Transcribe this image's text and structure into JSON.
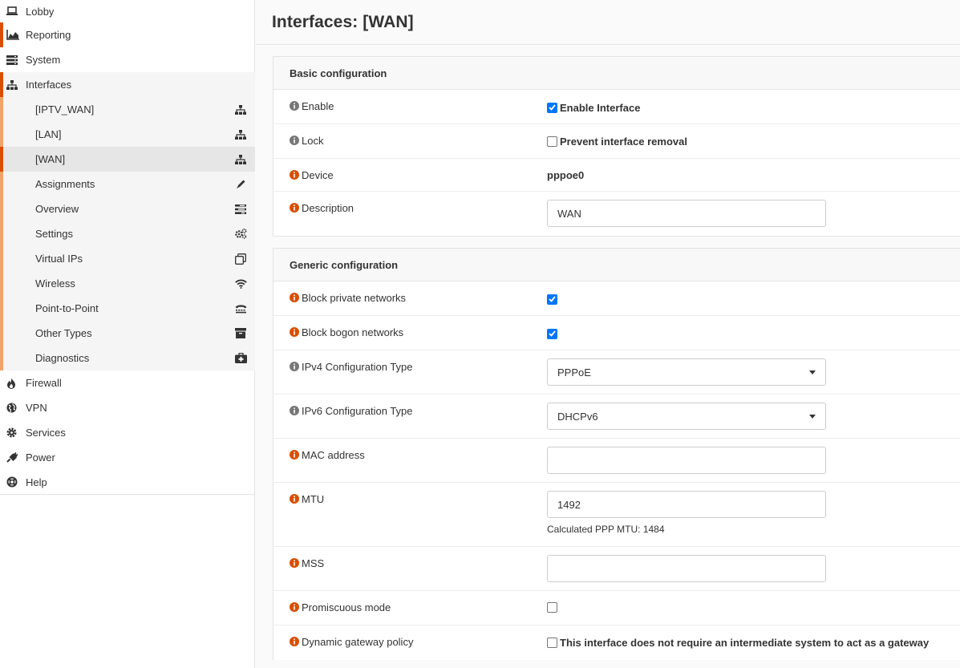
{
  "sidebar": {
    "top_items": [
      {
        "label": "Lobby",
        "icon": "laptop-icon"
      },
      {
        "label": "Reporting",
        "icon": "area-chart-icon"
      },
      {
        "label": "System",
        "icon": "server-icon"
      },
      {
        "label": "Interfaces",
        "icon": "sitemap-icon"
      }
    ],
    "sub_items": [
      {
        "label": "[IPTV_WAN]",
        "icon": "sitemap-icon"
      },
      {
        "label": "[LAN]",
        "icon": "sitemap-icon"
      },
      {
        "label": "[WAN]",
        "icon": "sitemap-icon"
      },
      {
        "label": "Assignments",
        "icon": "pencil-icon"
      },
      {
        "label": "Overview",
        "icon": "tasks-icon"
      },
      {
        "label": "Settings",
        "icon": "cogs-icon"
      },
      {
        "label": "Virtual IPs",
        "icon": "clone-icon"
      },
      {
        "label": "Wireless",
        "icon": "wifi-icon"
      },
      {
        "label": "Point-to-Point",
        "icon": "tty-icon"
      },
      {
        "label": "Other Types",
        "icon": "archive-icon"
      },
      {
        "label": "Diagnostics",
        "icon": "medkit-icon"
      }
    ],
    "bottom_items": [
      {
        "label": "Firewall",
        "icon": "fire-icon"
      },
      {
        "label": "VPN",
        "icon": "globe-icon"
      },
      {
        "label": "Services",
        "icon": "cog-icon"
      },
      {
        "label": "Power",
        "icon": "plug-icon"
      },
      {
        "label": "Help",
        "icon": "life-ring-icon"
      }
    ],
    "accent": "#d94f00",
    "sub_accent": "#f0a36b"
  },
  "page": {
    "title": "Interfaces: [WAN]"
  },
  "basic": {
    "heading": "Basic configuration",
    "enable_label": "Enable",
    "enable_checkbox_label": "Enable Interface",
    "enable_checked": true,
    "lock_label": "Lock",
    "lock_checkbox_label": "Prevent interface removal",
    "lock_checked": false,
    "device_label": "Device",
    "device_value": "pppoe0",
    "description_label": "Description",
    "description_value": "WAN"
  },
  "generic": {
    "heading": "Generic configuration",
    "block_private_label": "Block private networks",
    "block_private_checked": true,
    "block_bogon_label": "Block bogon networks",
    "block_bogon_checked": true,
    "ipv4_label": "IPv4 Configuration Type",
    "ipv4_value": "PPPoE",
    "ipv6_label": "IPv6 Configuration Type",
    "ipv6_value": "DHCPv6",
    "mac_label": "MAC address",
    "mac_value": "",
    "mtu_label": "MTU",
    "mtu_value": "1492",
    "mtu_help": "Calculated PPP MTU: 1484",
    "mss_label": "MSS",
    "mss_value": "",
    "promisc_label": "Promiscuous mode",
    "promisc_checked": false,
    "dyn_gw_label": "Dynamic gateway policy",
    "dyn_gw_checkbox_label": "This interface does not require an intermediate system to act as a gateway",
    "dyn_gw_checked": false
  },
  "colors": {
    "info_orange": "#d94f00",
    "info_gray": "#777777",
    "checkbox_blue": "#0075ff"
  }
}
